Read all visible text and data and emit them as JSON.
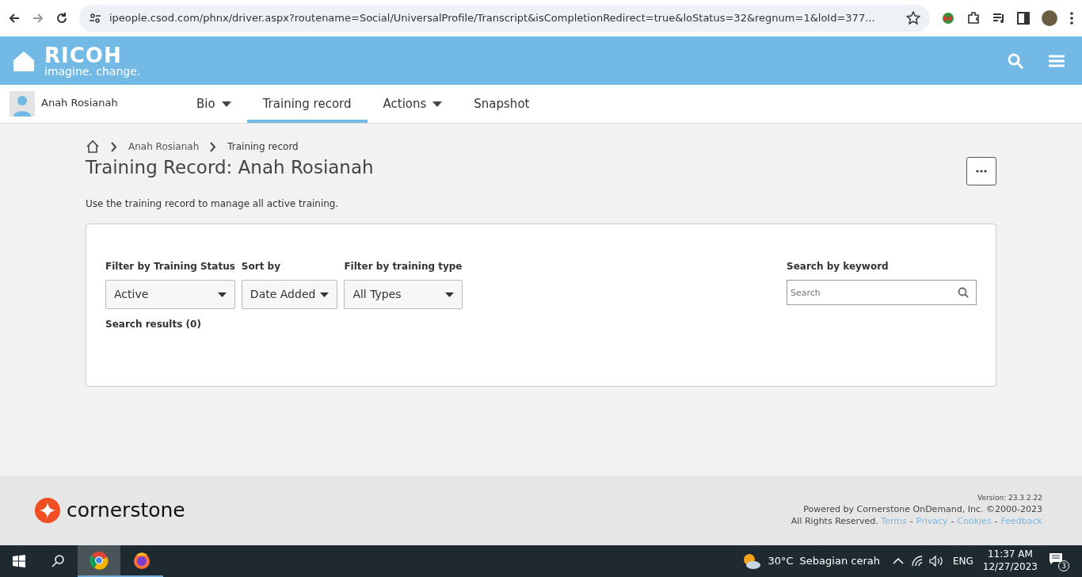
{
  "browser": {
    "url": "ipeople.csod.com/phnx/driver.aspx?routename=Social/UniversalProfile/Transcript&isCompletionRedirect=true&loStatus=32&regnum=1&loId=377..."
  },
  "header": {
    "logo": "RICOH",
    "tagline": "imagine. change."
  },
  "profile": {
    "name": "Anah Rosianah"
  },
  "tabs": [
    {
      "label": "Bio",
      "kind": "menu",
      "selected": false
    },
    {
      "label": "Training record",
      "kind": "link",
      "selected": true
    },
    {
      "label": "Actions",
      "kind": "menu",
      "selected": false
    },
    {
      "label": "Snapshot",
      "kind": "link",
      "selected": false
    }
  ],
  "breadcrumb": [
    "Anah Rosianah",
    "Training record"
  ],
  "page": {
    "title": "Training Record: Anah Rosianah",
    "description": "Use the training record to manage all active training."
  },
  "filters": [
    {
      "label": "Filter by Training Status",
      "value": "Active"
    },
    {
      "label": "Sort by",
      "value": "Date Added"
    },
    {
      "label": "Filter by training type",
      "value": "All Types"
    }
  ],
  "search": {
    "label": "Search by keyword",
    "placeholder": "Search"
  },
  "results": "Search results (0)",
  "footer": {
    "brand": "cornerstone",
    "version": "Version: 23.3.2.22",
    "powered": "Powered by Cornerstone OnDemand, Inc. ©2000-2023",
    "rights": "All Rights Reserved.",
    "links": [
      "Terms",
      "Privacy",
      "Cookies",
      "Feedback"
    ],
    "separator": "-"
  },
  "taskbar": {
    "apps": [
      {
        "kind": "chrome",
        "selected": true
      },
      {
        "kind": "firefox",
        "selected": false
      }
    ],
    "temperature": "30°C",
    "weather": "Sebagian cerah",
    "language": "ENG",
    "time": "11:37 AM",
    "date": "12/27/2023",
    "notifications": "3"
  }
}
